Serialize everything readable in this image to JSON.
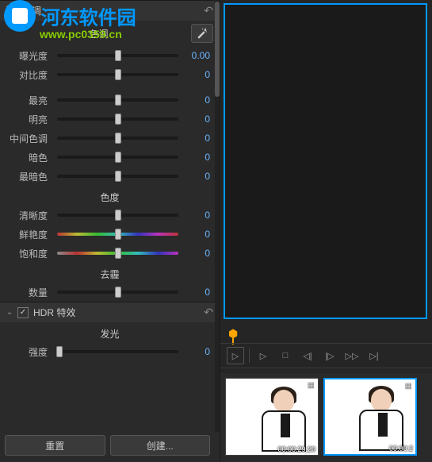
{
  "watermark": {
    "text": "河东软件园",
    "url": "www.pc0359.cn"
  },
  "sections": {
    "tone_checkbox": "色调",
    "hdr": "HDR 特效"
  },
  "groups": {
    "tone": "色调",
    "brightness_group": "",
    "chroma": "色度",
    "dehaze": "去霾",
    "glow": "发光"
  },
  "sliders": {
    "exposure": {
      "label": "曝光度",
      "value": "0.00"
    },
    "contrast": {
      "label": "对比度",
      "value": "0"
    },
    "brightest": {
      "label": "最亮",
      "value": "0"
    },
    "bright": {
      "label": "明亮",
      "value": "0"
    },
    "midtone": {
      "label": "中间色调",
      "value": "0"
    },
    "dark": {
      "label": "暗色",
      "value": "0"
    },
    "darkest": {
      "label": "最暗色",
      "value": "0"
    },
    "clarity": {
      "label": "清晰度",
      "value": "0"
    },
    "vibrance": {
      "label": "鲜艳度",
      "value": "0"
    },
    "saturation": {
      "label": "饱和度",
      "value": "0"
    },
    "amount": {
      "label": "数量",
      "value": "0"
    },
    "intensity": {
      "label": "强度",
      "value": "0"
    }
  },
  "buttons": {
    "reset": "重置",
    "create": "创建..."
  },
  "thumbnails": [
    {
      "timecode": "00:00:29;20"
    },
    {
      "timecode": "00:00:2"
    }
  ]
}
